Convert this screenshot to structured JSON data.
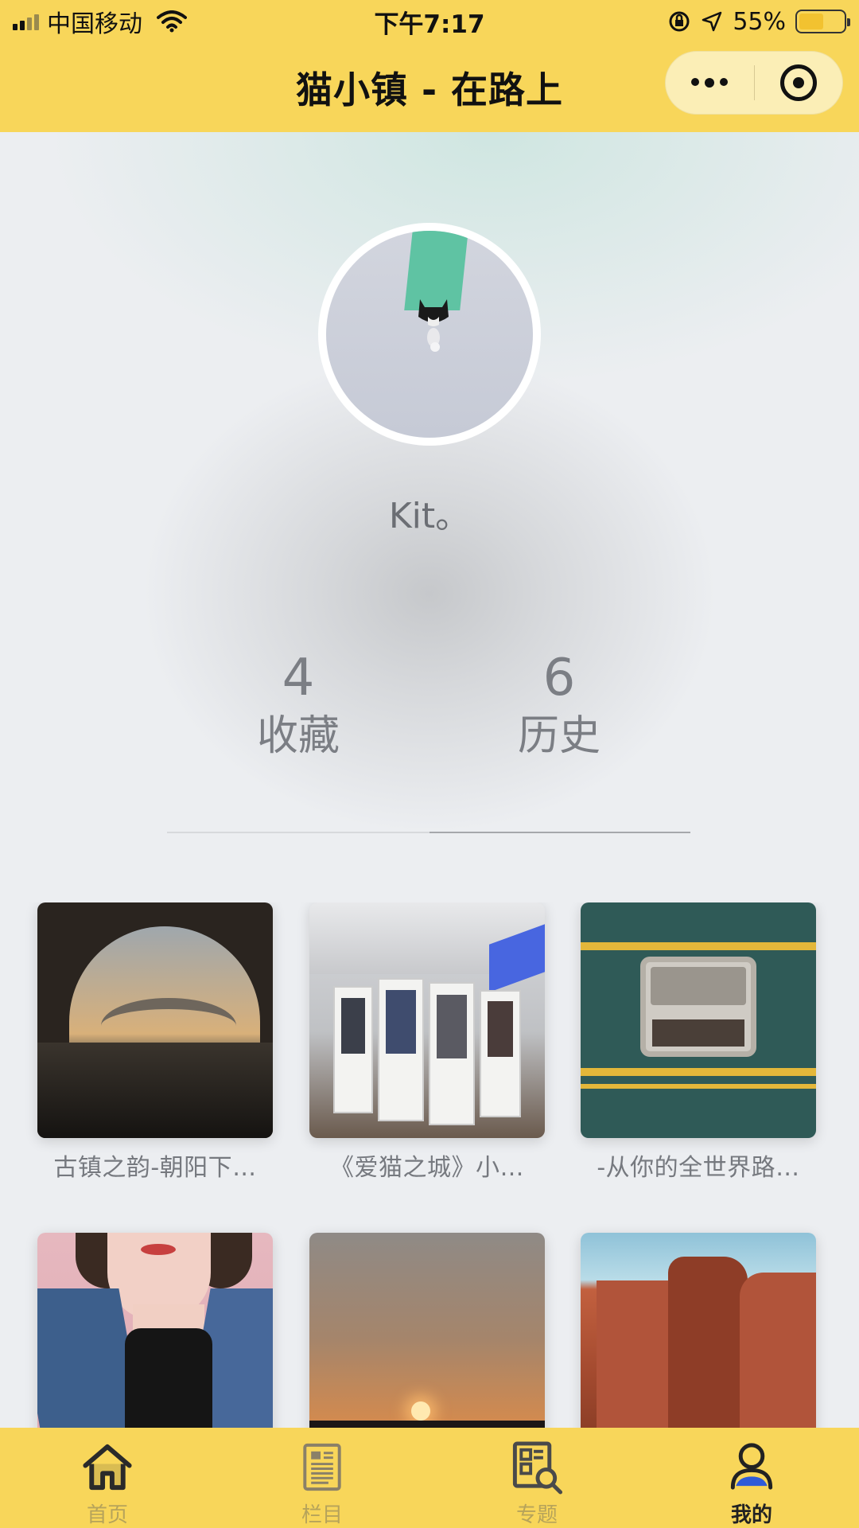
{
  "status_bar": {
    "carrier": "中国移动",
    "time": "下午7:17",
    "battery": "55%",
    "battery_level": 0.55
  },
  "nav": {
    "title": "猫小镇 - 在路上",
    "more_icon": "more-dots-icon",
    "close_icon": "target-circle-icon"
  },
  "profile": {
    "username": "Kit。",
    "stats": [
      {
        "count": "4",
        "label": "收藏"
      },
      {
        "count": "6",
        "label": "历史"
      }
    ],
    "active_tab": "历史"
  },
  "items": [
    {
      "caption": "古镇之韵-朝阳下…"
    },
    {
      "caption": "《爱猫之城》小…"
    },
    {
      "caption": "-从你的全世界路…"
    },
    {
      "caption": ""
    },
    {
      "caption": ""
    },
    {
      "caption": ""
    }
  ],
  "tabbar": {
    "tabs": [
      {
        "label": "首页",
        "icon": "home-icon"
      },
      {
        "label": "栏目",
        "icon": "newspaper-icon"
      },
      {
        "label": "专题",
        "icon": "search-doc-icon"
      },
      {
        "label": "我的",
        "icon": "user-icon",
        "active": true
      }
    ]
  },
  "colors": {
    "brand_yellow": "#f8d65a",
    "capsule_bg": "#fbeeb6",
    "text_muted": "#7b7e84"
  }
}
